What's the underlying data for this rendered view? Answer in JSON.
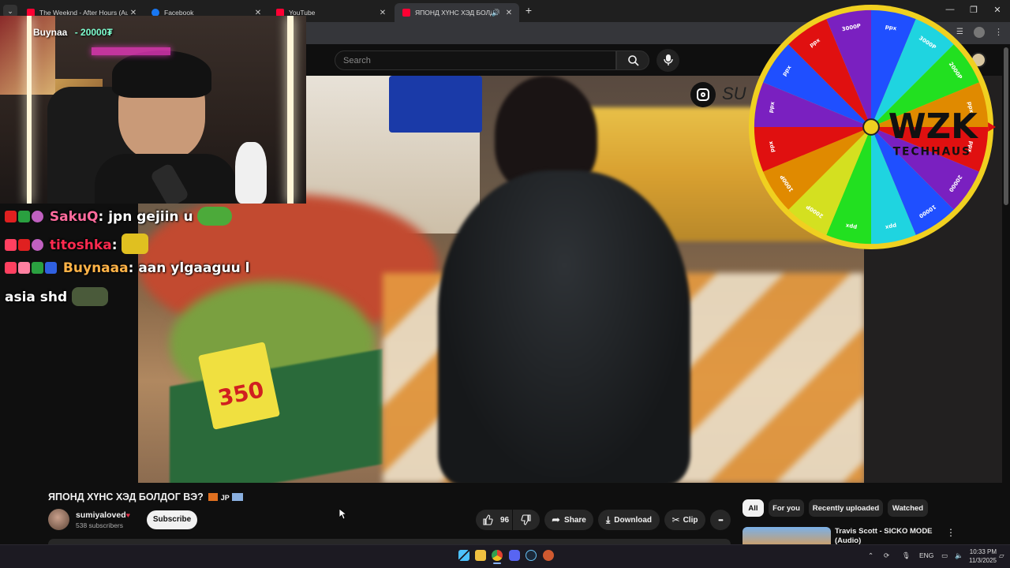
{
  "browser": {
    "tabs": [
      {
        "label": "The Weeknd - After Hours (Au",
        "icon": "youtube-icon",
        "color": "#ff0033"
      },
      {
        "label": "Facebook",
        "icon": "facebook-icon",
        "color": "#1877f2"
      },
      {
        "label": "YouTube",
        "icon": "youtube-icon",
        "color": "#ff0033"
      },
      {
        "label": "ЯПОНД ХҮНС ХЭД БОЛДО",
        "icon": "youtube-icon",
        "color": "#ff0033",
        "active": true
      }
    ]
  },
  "youtube": {
    "search_placeholder": "Search",
    "video_title": "ЯПОНД ХҮНС ХЭД БОЛДОГ ВЭ?",
    "video_title_suffix": "JP",
    "channel_name": "sumiyaloved",
    "subscribers": "538 subscribers",
    "subscribe_label": "Subscribe",
    "likes": "96",
    "share_label": "Share",
    "download_label": "Download",
    "clip_label": "Clip",
    "more_label": "•••",
    "chips": [
      "All",
      "For you",
      "Recently uploaded",
      "Watched"
    ],
    "recommended": {
      "title": "Travis Scott - SICKO MODE",
      "title_line2": "(Audio)"
    },
    "video_overlay_text": "SU",
    "price_sign": "350"
  },
  "stream": {
    "donation": {
      "name": "Buynaa",
      "amount": "- 20000₮"
    },
    "chat": [
      {
        "user": "SakuQ",
        "message": "jpn gejiin u",
        "user_color": "#ff6b9d"
      },
      {
        "user": "titoshka",
        "message": "",
        "user_color": "#ff2a4f"
      },
      {
        "user": "Buynaaa",
        "message": "aan ylgaaguu l",
        "user_color": "#ffb347"
      }
    ],
    "chat_continuation": "asia shd"
  },
  "wheel": {
    "logo": "WZK",
    "logo_sub": "TECHHAUS",
    "colors": [
      "#1f4fff",
      "#1fd4e0",
      "#22e020",
      "#e08a00",
      "#e01010",
      "#7a20c0",
      "#1f4fff",
      "#1fd4e0",
      "#22e020",
      "#d4e020",
      "#e08a00",
      "#e01010",
      "#7a20c0",
      "#1f4fff",
      "#e01010",
      "#7a20c0"
    ],
    "labels": [
      "ppx",
      "3000P",
      "2000P",
      "ppx",
      "ppx",
      "20000",
      "10000",
      "ppx",
      "ppx",
      "2000P",
      "1000P",
      "ppx",
      "ppx",
      "ppx",
      "ppx",
      "3000P"
    ]
  },
  "taskbar": {
    "language": "ENG",
    "time": "10:33 PM",
    "date": "11/3/2025"
  }
}
